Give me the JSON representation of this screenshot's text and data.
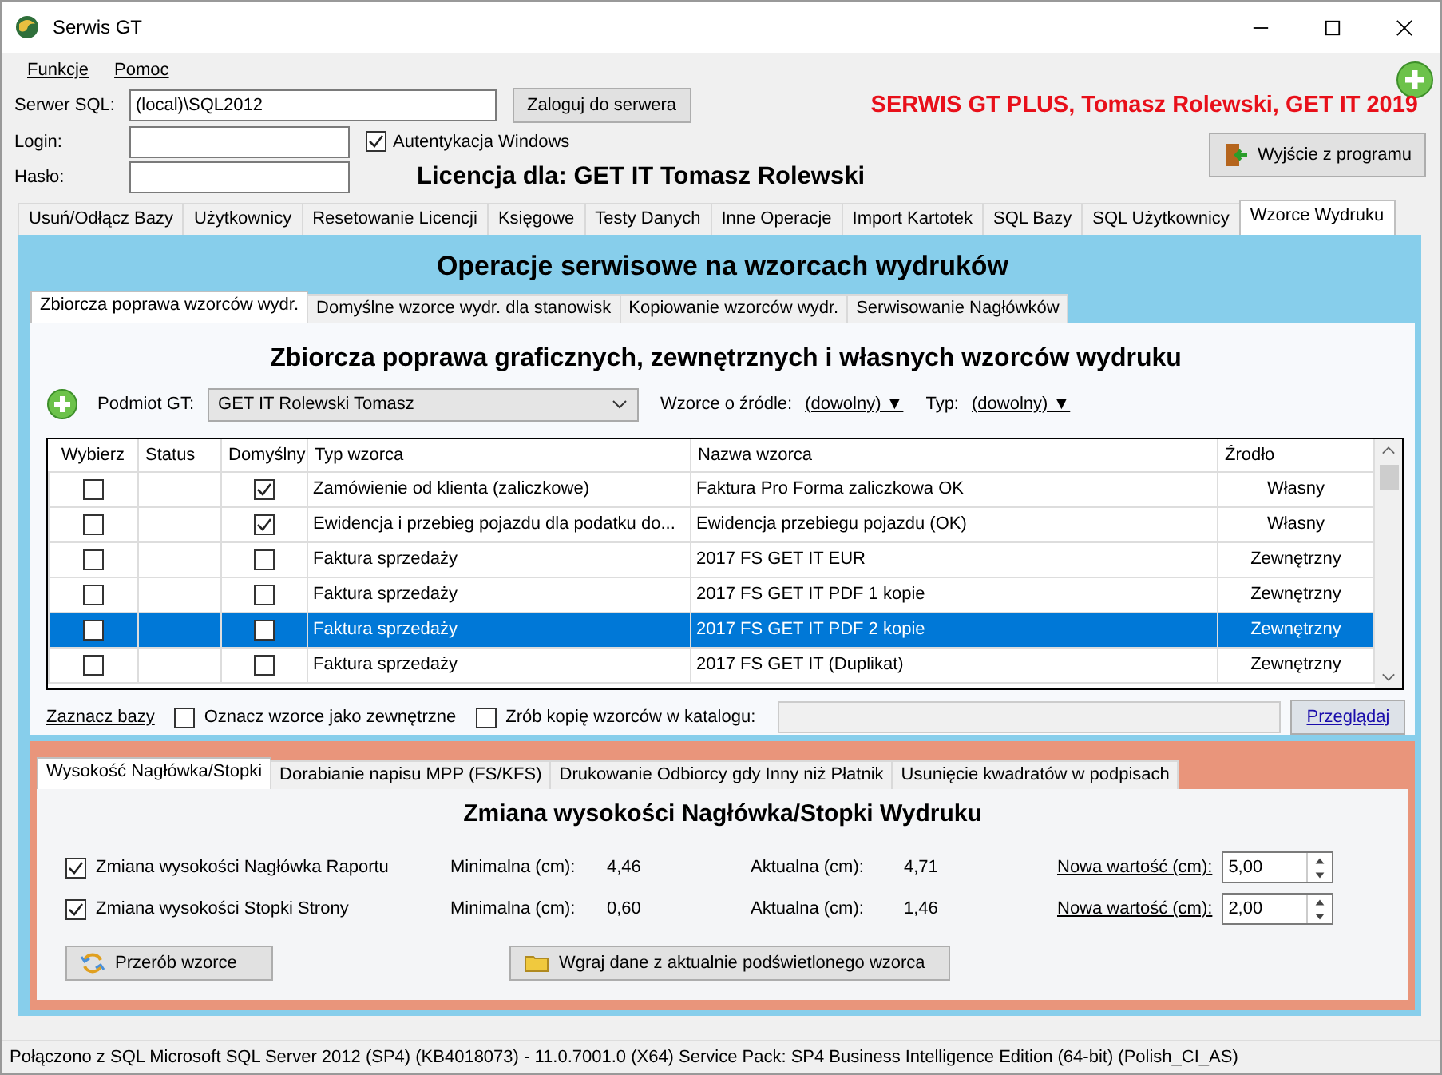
{
  "window": {
    "title": "Serwis GT"
  },
  "menu": [
    {
      "label": "Funkcje"
    },
    {
      "label": "Pomoc"
    }
  ],
  "connection": {
    "server_label": "Serwer SQL:",
    "server_value": "(local)\\SQL2012",
    "login_button": "Zaloguj do serwera",
    "login_label": "Login:",
    "password_label": "Hasło:",
    "windows_auth": {
      "label": "Autentykacja Windows",
      "checked": true
    }
  },
  "brand": "SERWIS GT PLUS, Tomasz Rolewski, GET IT 2019",
  "license": "Licencja dla: GET IT Tomasz Rolewski",
  "exit_button": "Wyjście z programu",
  "tabs": [
    {
      "label": "Usuń/Odłącz Bazy",
      "selected": false
    },
    {
      "label": "Użytkownicy",
      "selected": false
    },
    {
      "label": "Resetowanie Licencji",
      "selected": false
    },
    {
      "label": "Księgowe",
      "selected": false
    },
    {
      "label": "Testy Danych",
      "selected": false
    },
    {
      "label": "Inne Operacje",
      "selected": false
    },
    {
      "label": "Import Kartotek",
      "selected": false
    },
    {
      "label": "SQL Bazy",
      "selected": false
    },
    {
      "label": "SQL Użytkownicy",
      "selected": false
    },
    {
      "label": "Wzorce Wydruku",
      "selected": true
    }
  ],
  "panel": {
    "title": "Operacje serwisowe na wzorcach wydruków",
    "subtabs": [
      {
        "label": "Zbiorcza poprawa wzorców wydr.",
        "selected": true
      },
      {
        "label": "Domyślne wzorce wydr. dla stanowisk",
        "selected": false
      },
      {
        "label": "Kopiowanie wzorców wydr.",
        "selected": false
      },
      {
        "label": "Serwisowanie Nagłówków",
        "selected": false
      }
    ],
    "heading": "Zbiorcza poprawa graficznych, zewnętrznych i własnych wzorców wydruku",
    "filters": {
      "subject_label": "Podmiot GT:",
      "subject_value": "GET IT Rolewski Tomasz",
      "source_label": "Wzorce o źródle:",
      "source_value": "(dowolny) ▼",
      "type_label": "Typ:",
      "type_value": "(dowolny) ▼"
    },
    "table": {
      "columns": [
        "Wybierz",
        "Status",
        "Domyślny",
        "Typ wzorca",
        "Nazwa wzorca",
        "Źrodło"
      ],
      "rows": [
        {
          "choose": false,
          "default": true,
          "type": "Zamówienie od klienta (zaliczkowe)",
          "name": "Faktura Pro Forma zaliczkowa OK",
          "source": "Własny",
          "selected": false
        },
        {
          "choose": false,
          "default": true,
          "type": "Ewidencja i przebieg pojazdu dla podatku do...",
          "name": "Ewidencja przebiegu pojazdu (OK)",
          "source": "Własny",
          "selected": false
        },
        {
          "choose": false,
          "default": false,
          "type": "Faktura sprzedaży",
          "name": "2017 FS GET IT EUR",
          "source": "Zewnętrzny",
          "selected": false
        },
        {
          "choose": false,
          "default": false,
          "type": "Faktura sprzedaży",
          "name": "2017 FS GET IT PDF 1 kopie",
          "source": "Zewnętrzny",
          "selected": false
        },
        {
          "choose": false,
          "default": false,
          "type": "Faktura sprzedaży",
          "name": "2017 FS GET IT PDF 2 kopie",
          "source": "Zewnętrzny",
          "selected": true
        },
        {
          "choose": false,
          "default": false,
          "type": "Faktura sprzedaży",
          "name": "2017 FS GET IT (Duplikat)",
          "source": "Zewnętrzny",
          "selected": false
        }
      ]
    },
    "actions": {
      "mark_link": "Zaznacz bazy",
      "mark_external": {
        "label": "Oznacz wzorce jako zewnętrzne",
        "checked": false
      },
      "copy": {
        "label": "Zrób kopię wzorców w katalogu:",
        "checked": false
      },
      "browse_button": "Przeglądaj"
    }
  },
  "header_footer": {
    "tabs": [
      {
        "label": "Wysokość Nagłówka/Stopki",
        "selected": true
      },
      {
        "label": "Dorabianie napisu MPP (FS/KFS)",
        "selected": false
      },
      {
        "label": "Drukowanie Odbiorcy gdy Inny niż Płatnik",
        "selected": false
      },
      {
        "label": "Usunięcie kwadratów w podpisach",
        "selected": false
      }
    ],
    "heading": "Zmiana wysokości Nagłówka/Stopki Wydruku",
    "rows": [
      {
        "label": "Zmiana wysokości Nagłówka Raportu",
        "checked": true,
        "min_label": "Minimalna (cm):",
        "min": "4,46",
        "cur_label": "Aktualna (cm):",
        "cur": "4,71",
        "new_label": "Nowa wartość (cm):",
        "new_value": "5,00"
      },
      {
        "label": "Zmiana wysokości Stopki Strony",
        "checked": true,
        "min_label": "Minimalna (cm):",
        "min": "0,60",
        "cur_label": "Aktualna (cm):",
        "cur": "1,46",
        "new_label": "Nowa wartość (cm):",
        "new_value": "2,00"
      }
    ],
    "rebuild_button": "Przerób wzorce",
    "load_button": "Wgraj dane z aktualnie podświetlonego wzorca"
  },
  "status_bar": "Połączono z SQL  Microsoft SQL Server 2012 (SP4) (KB4018073) - 11.0.7001.0 (X64)  Service Pack: SP4 Business Intelligence Edition (64-bit) (Polish_CI_AS)"
}
